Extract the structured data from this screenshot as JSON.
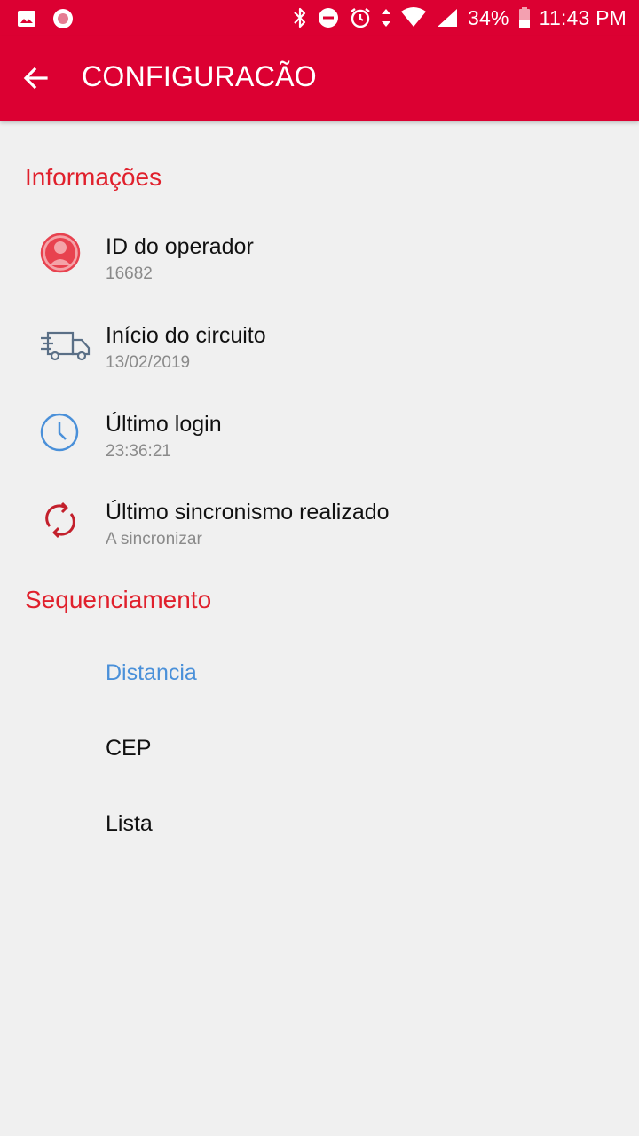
{
  "status_bar": {
    "battery": "34%",
    "time": "11:43 PM",
    "icons": [
      "image-icon",
      "record-icon",
      "bluetooth-icon",
      "do-not-disturb-icon",
      "alarm-icon",
      "data-arrows-icon",
      "wifi-icon",
      "signal-icon",
      "battery-icon"
    ]
  },
  "app_bar": {
    "title": "CONFIGURACÃO",
    "back_icon": "arrow-left-icon"
  },
  "sections": {
    "info": {
      "title": "Informações",
      "items": [
        {
          "title": "ID do operador",
          "subtitle": "16682",
          "icon": "person-icon"
        },
        {
          "title": "Início do circuito",
          "subtitle": "13/02/2019",
          "icon": "truck-icon"
        },
        {
          "title": "Último login",
          "subtitle": "23:36:21",
          "icon": "clock-icon"
        },
        {
          "title": "Último sincronismo realizado",
          "subtitle": "A sincronizar",
          "icon": "sync-icon"
        }
      ]
    },
    "sequencing": {
      "title": "Sequenciamento",
      "options": [
        "Distancia",
        "CEP",
        "Lista"
      ],
      "selected": "Distancia"
    }
  },
  "colors": {
    "primary": "#dc0032",
    "section_title": "#e0202c",
    "selected_option": "#4a90d9",
    "background": "#f0f0f0",
    "icon_person": "#e8424f",
    "icon_truck": "#5a6f86",
    "icon_clock": "#4a90d9",
    "icon_sync": "#c3202c"
  }
}
